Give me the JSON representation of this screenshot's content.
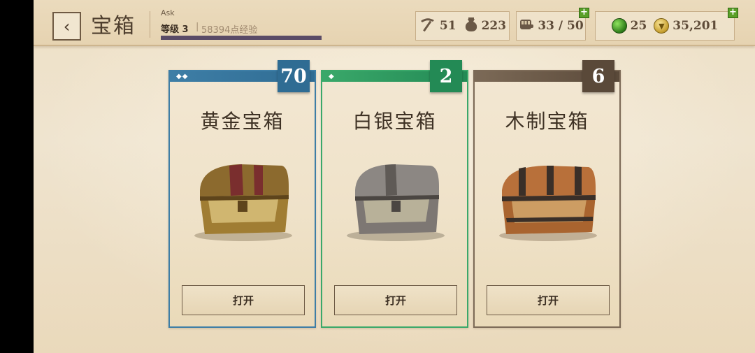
{
  "header": {
    "back_icon": "chevron-left-icon",
    "title": "宝箱",
    "player": {
      "name": "Ask",
      "level": "等级 3",
      "separator": "|",
      "xp": "58394点经验",
      "xp_progress": 1.0
    }
  },
  "resources": {
    "pickaxe": {
      "icon": "pickaxe-icon",
      "value": "51"
    },
    "bag": {
      "icon": "bag-icon",
      "value": "223"
    },
    "capacity": {
      "icon": "fist-icon",
      "value": "33 / 50"
    },
    "gems": {
      "icon": "gem-icon",
      "value": "25",
      "color": "#3f9a1e"
    },
    "gold": {
      "icon": "coin-icon",
      "value": "35,201",
      "color": "#c9a233"
    }
  },
  "chests": [
    {
      "id": "gold",
      "name": "黄金宝箱",
      "count": "70",
      "diamonds": "◆◆",
      "accent": "#3e7ea6",
      "badge": "#2f6c93",
      "open_label": "打开",
      "icon": "gold-chest-icon"
    },
    {
      "id": "silver",
      "name": "白银宝箱",
      "count": "2",
      "diamonds": "◆",
      "accent": "#3aa86a",
      "badge": "#238a55",
      "open_label": "打开",
      "icon": "silver-chest-icon"
    },
    {
      "id": "wood",
      "name": "木制宝箱",
      "count": "6",
      "diamonds": "",
      "accent": "#7c6a57",
      "badge": "#5a4939",
      "open_label": "打开",
      "icon": "wooden-chest-icon"
    }
  ]
}
